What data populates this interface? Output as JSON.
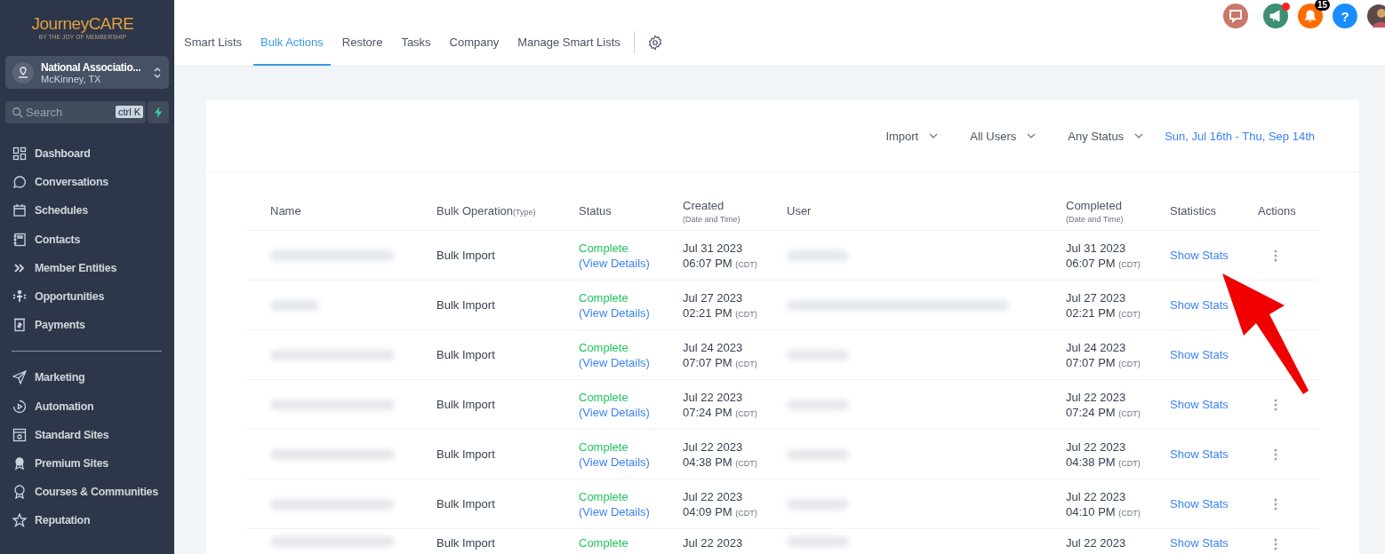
{
  "sidebar": {
    "logo": {
      "name": "JourneyCARE",
      "tagline": "BY THE JOY OF MEMBERSHIP"
    },
    "account": {
      "name": "National Associatio...",
      "location": "McKinney, TX"
    },
    "search": {
      "placeholder": "Search",
      "shortcut": "ctrl K"
    },
    "groups": [
      [
        {
          "label": "Dashboard"
        },
        {
          "label": "Conversations"
        },
        {
          "label": "Schedules"
        },
        {
          "label": "Contacts"
        },
        {
          "label": "Member Entities"
        },
        {
          "label": "Opportunities"
        },
        {
          "label": "Payments"
        }
      ],
      [
        {
          "label": "Marketing"
        },
        {
          "label": "Automation"
        },
        {
          "label": "Standard Sites"
        },
        {
          "label": "Premium Sites"
        },
        {
          "label": "Courses & Communities"
        },
        {
          "label": "Reputation"
        }
      ]
    ]
  },
  "topbar": {
    "notifications": "15",
    "help": "?",
    "announcement_unread": true
  },
  "tabs": [
    {
      "label": "Smart Lists",
      "selected": false
    },
    {
      "label": "Bulk Actions",
      "selected": true
    },
    {
      "label": "Restore",
      "selected": false
    },
    {
      "label": "Tasks",
      "selected": false
    },
    {
      "label": "Company",
      "selected": false
    },
    {
      "label": "Manage Smart Lists",
      "selected": false
    }
  ],
  "filters": [
    {
      "label": "Import"
    },
    {
      "label": "All Users"
    },
    {
      "label": "Any Status"
    }
  ],
  "date_range": "Sun, Jul 16th - Thu, Sep 14th",
  "table": {
    "columns": [
      {
        "label": "Name"
      },
      {
        "label": "Bulk Operation",
        "note": "(Type)",
        "stacked": false
      },
      {
        "label": "Status"
      },
      {
        "label": "Created",
        "note": "(Date and Time)",
        "stacked": true
      },
      {
        "label": "User"
      },
      {
        "label": "Completed",
        "note": "(Date and Time)",
        "stacked": true
      },
      {
        "label": "Statistics"
      },
      {
        "label": "Actions"
      }
    ],
    "rows": [
      {
        "operation": "Bulk Import",
        "status": "Complete",
        "details": "(View Details)",
        "created_date": "Jul 31 2023",
        "created_time": "06:07 PM",
        "created_tz": "(CDT)",
        "completed_date": "Jul 31 2023",
        "completed_time": "06:07 PM",
        "completed_tz": "(CDT)",
        "stats": "Show Stats",
        "menu": true
      },
      {
        "operation": "Bulk Import",
        "status": "Complete",
        "details": "(View Details)",
        "created_date": "Jul 27 2023",
        "created_time": "02:21 PM",
        "created_tz": "(CDT)",
        "completed_date": "Jul 27 2023",
        "completed_time": "02:21 PM",
        "completed_tz": "(CDT)",
        "stats": "Show Stats",
        "menu": false
      },
      {
        "operation": "Bulk Import",
        "status": "Complete",
        "details": "(View Details)",
        "created_date": "Jul 24 2023",
        "created_time": "07:07 PM",
        "created_tz": "(CDT)",
        "completed_date": "Jul 24 2023",
        "completed_time": "07:07 PM",
        "completed_tz": "(CDT)",
        "stats": "Show Stats",
        "menu": false
      },
      {
        "operation": "Bulk Import",
        "status": "Complete",
        "details": "(View Details)",
        "created_date": "Jul 22 2023",
        "created_time": "07:24 PM",
        "created_tz": "(CDT)",
        "completed_date": "Jul 22 2023",
        "completed_time": "07:24 PM",
        "completed_tz": "(CDT)",
        "stats": "Show Stats",
        "menu": true
      },
      {
        "operation": "Bulk Import",
        "status": "Complete",
        "details": "(View Details)",
        "created_date": "Jul 22 2023",
        "created_time": "04:38 PM",
        "created_tz": "(CDT)",
        "completed_date": "Jul 22 2023",
        "completed_time": "04:38 PM",
        "completed_tz": "(CDT)",
        "stats": "Show Stats",
        "menu": true
      },
      {
        "operation": "Bulk Import",
        "status": "Complete",
        "details": "(View Details)",
        "created_date": "Jul 22 2023",
        "created_time": "04:09 PM",
        "created_tz": "(CDT)",
        "completed_date": "Jul 22 2023",
        "completed_time": "04:10 PM",
        "completed_tz": "(CDT)",
        "stats": "Show Stats",
        "menu": true
      },
      {
        "operation": "Bulk Import",
        "status": "Complete",
        "created_date": "Jul 22 2023",
        "completed_date": "Jul 22 2023",
        "stats": "Show Stats",
        "menu": true
      }
    ]
  },
  "annotation": {
    "kind": "arrow"
  }
}
